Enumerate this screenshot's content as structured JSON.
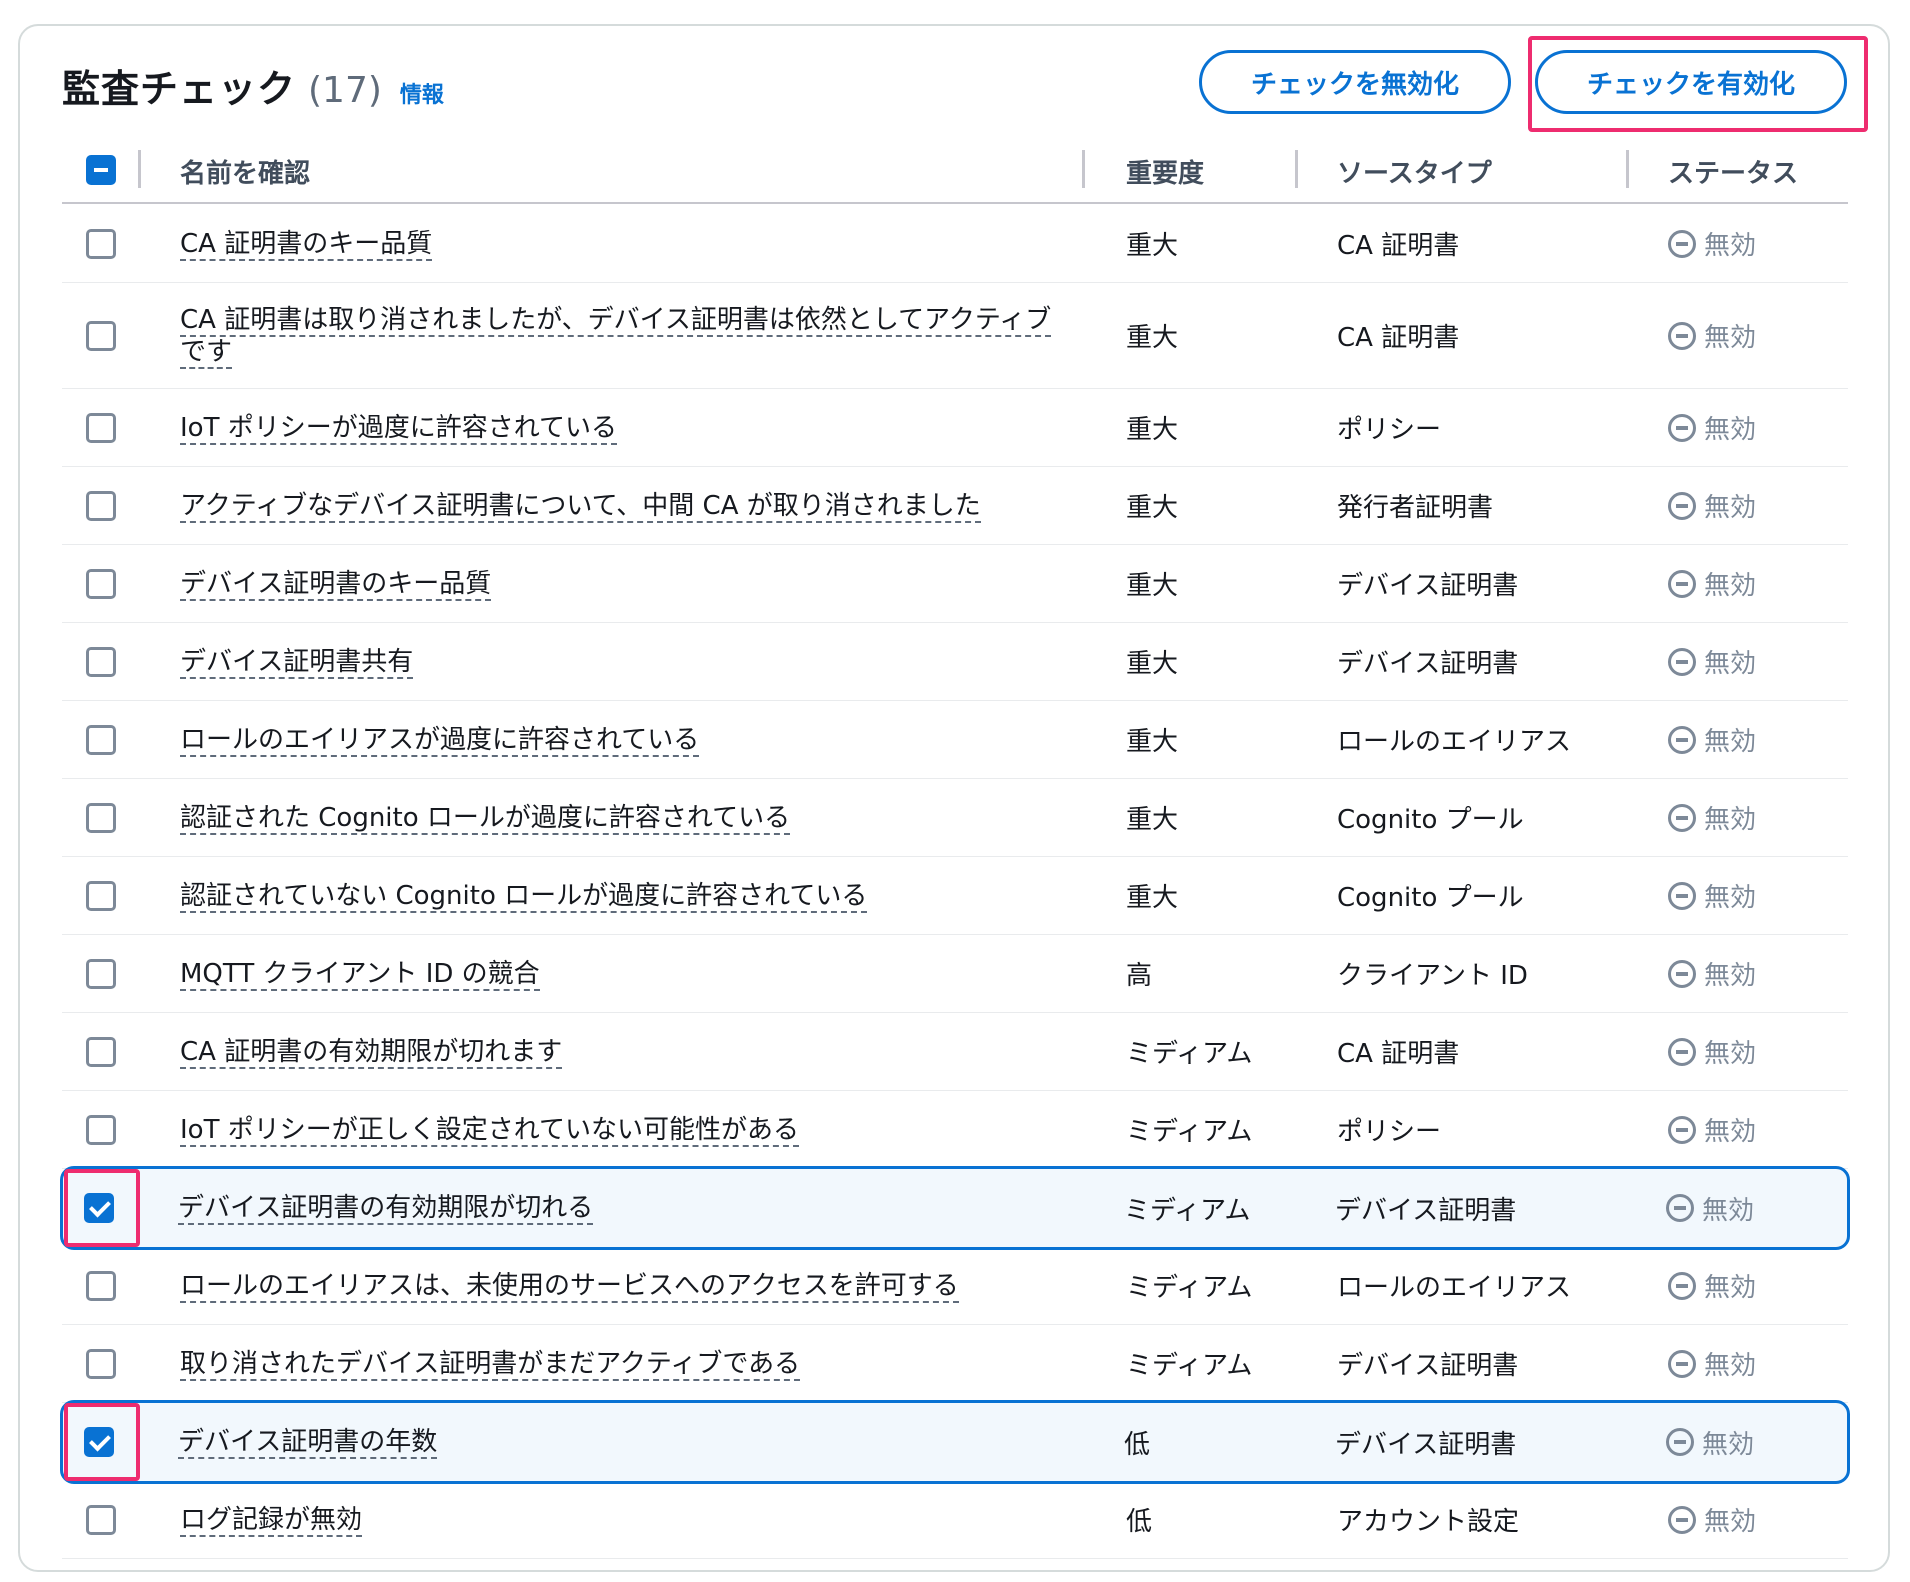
{
  "header": {
    "title": "監査チェック",
    "count": "(17)",
    "info_link": "情報",
    "disable_button": "チェックを無効化",
    "enable_button": "チェックを有効化"
  },
  "columns": {
    "name": "名前を確認",
    "severity": "重要度",
    "source_type": "ソースタイプ",
    "status": "ステータス"
  },
  "rows": [
    {
      "name": "CA 証明書のキー品質",
      "severity": "重大",
      "source_type": "CA 証明書",
      "status": "無効",
      "checked": false
    },
    {
      "name": "CA 証明書は取り消されましたが、デバイス証明書は依然としてアクティブです",
      "severity": "重大",
      "source_type": "CA 証明書",
      "status": "無効",
      "checked": false
    },
    {
      "name": "IoT ポリシーが過度に許容されている",
      "severity": "重大",
      "source_type": "ポリシー",
      "status": "無効",
      "checked": false
    },
    {
      "name": "アクティブなデバイス証明書について、中間 CA が取り消されました",
      "severity": "重大",
      "source_type": "発行者証明書",
      "status": "無効",
      "checked": false
    },
    {
      "name": "デバイス証明書のキー品質",
      "severity": "重大",
      "source_type": "デバイス証明書",
      "status": "無効",
      "checked": false
    },
    {
      "name": "デバイス証明書共有",
      "severity": "重大",
      "source_type": "デバイス証明書",
      "status": "無効",
      "checked": false
    },
    {
      "name": "ロールのエイリアスが過度に許容されている",
      "severity": "重大",
      "source_type": "ロールのエイリアス",
      "status": "無効",
      "checked": false
    },
    {
      "name": "認証された Cognito ロールが過度に許容されている",
      "severity": "重大",
      "source_type": "Cognito プール",
      "status": "無効",
      "checked": false
    },
    {
      "name": "認証されていない Cognito ロールが過度に許容されている",
      "severity": "重大",
      "source_type": "Cognito プール",
      "status": "無効",
      "checked": false
    },
    {
      "name": "MQTT クライアント ID の競合",
      "severity": "高",
      "source_type": "クライアント ID",
      "status": "無効",
      "checked": false
    },
    {
      "name": "CA 証明書の有効期限が切れます",
      "severity": "ミディアム",
      "source_type": "CA 証明書",
      "status": "無効",
      "checked": false
    },
    {
      "name": "IoT ポリシーが正しく設定されていない可能性がある",
      "severity": "ミディアム",
      "source_type": "ポリシー",
      "status": "無効",
      "checked": false
    },
    {
      "name": "デバイス証明書の有効期限が切れる",
      "severity": "ミディアム",
      "source_type": "デバイス証明書",
      "status": "無効",
      "checked": true
    },
    {
      "name": "ロールのエイリアスは、未使用のサービスへのアクセスを許可する",
      "severity": "ミディアム",
      "source_type": "ロールのエイリアス",
      "status": "無効",
      "checked": false
    },
    {
      "name": "取り消されたデバイス証明書がまだアクティブである",
      "severity": "ミディアム",
      "source_type": "デバイス証明書",
      "status": "無効",
      "checked": false
    },
    {
      "name": "デバイス証明書の年数",
      "severity": "低",
      "source_type": "デバイス証明書",
      "status": "無効",
      "checked": true
    },
    {
      "name": "ログ記録が無効",
      "severity": "低",
      "source_type": "アカウント設定",
      "status": "無効",
      "checked": false
    }
  ]
}
